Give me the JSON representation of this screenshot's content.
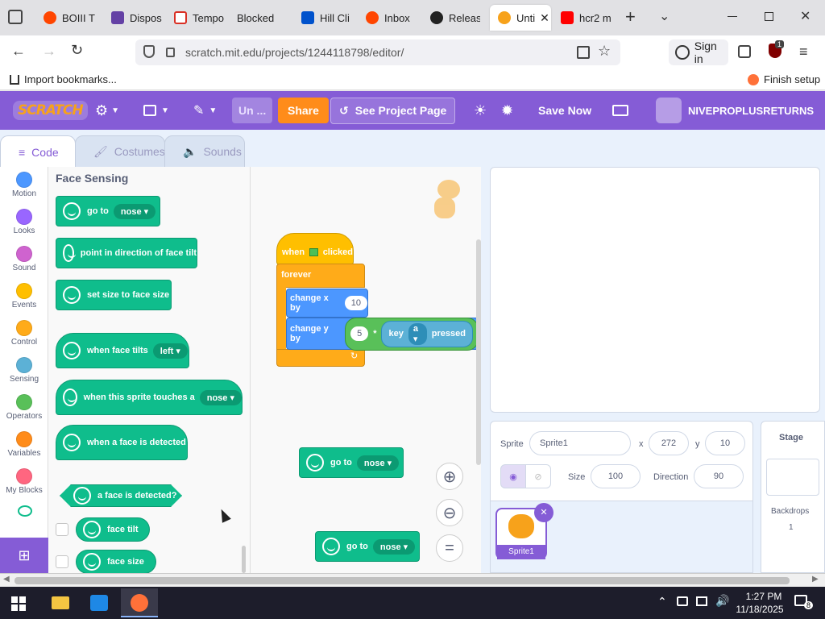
{
  "browser": {
    "tabs": [
      {
        "label": "BOIII T",
        "color": "#ff4500"
      },
      {
        "label": "Dispos",
        "color": "#6441a5"
      },
      {
        "label": "Tempo",
        "color": "#d93025"
      },
      {
        "label": "Blocked",
        "color": "#888888"
      },
      {
        "label": "Hill Cli",
        "color": "#0052cc"
      },
      {
        "label": "Inbox",
        "color": "#ff4500"
      },
      {
        "label": "Releas",
        "color": "#222222"
      },
      {
        "label": "Unti",
        "color": "#f7a21b"
      },
      {
        "label": "hcr2 m",
        "color": "#ff0000"
      }
    ],
    "url": "scratch.mit.edu/projects/1244118798/editor/",
    "sign_in": "Sign in",
    "import_bookmarks": "Import bookmarks...",
    "finish_setup": "Finish setup",
    "badge_count": "1"
  },
  "menubar": {
    "logo": "SCRATCH",
    "project_title": "Un ...",
    "share": "Share",
    "see_project": "See Project Page",
    "save_now": "Save Now",
    "username": "NIVEPROPLUSRETURNS"
  },
  "editor_tabs": {
    "code": "Code",
    "costumes": "Costumes",
    "sounds": "Sounds"
  },
  "categories": [
    {
      "label": "Motion",
      "color": "#4c97ff"
    },
    {
      "label": "Looks",
      "color": "#9966ff"
    },
    {
      "label": "Sound",
      "color": "#cf63cf"
    },
    {
      "label": "Events",
      "color": "#ffbf00"
    },
    {
      "label": "Control",
      "color": "#ffab19"
    },
    {
      "label": "Sensing",
      "color": "#5cb1d6"
    },
    {
      "label": "Operators",
      "color": "#59c059"
    },
    {
      "label": "Variables",
      "color": "#ff8c1a"
    },
    {
      "label": "My Blocks",
      "color": "#ff6680"
    }
  ],
  "palette": {
    "heading": "Face Sensing",
    "go_to": "go to",
    "go_to_opt": "nose",
    "point_direction": "point in direction of face tilt",
    "set_size": "set size to face size",
    "when_face_tilts": "when face tilts",
    "when_face_tilts_opt": "left",
    "when_sprite_touches": "when this sprite touches a",
    "when_sprite_touches_opt": "nose",
    "when_face_detected": "when a face is detected",
    "a_face_detected": "a face is detected?",
    "face_tilt": "face tilt",
    "face_size": "face size"
  },
  "scripts": {
    "when": "when",
    "clicked": "clicked",
    "forever": "forever",
    "change_x": "change x by",
    "change_x_val": "10",
    "change_y": "change y by",
    "change_y_val": "5",
    "op_symbol": "*",
    "key": "key",
    "key_opt": "a",
    "pressed": "pressed",
    "goto1": "go to",
    "goto1_opt": "nose",
    "goto2": "go to",
    "goto2_opt": "nose"
  },
  "sprite": {
    "label": "Sprite",
    "name": "Sprite1",
    "x_label": "x",
    "x": "272",
    "y_label": "y",
    "y": "10",
    "size_label": "Size",
    "size": "100",
    "direction_label": "Direction",
    "direction": "90",
    "thumb_name": "Sprite1"
  },
  "stage_pane": {
    "title": "Stage",
    "backdrops_label": "Backdrops",
    "backdrops_count": "1"
  },
  "taskbar": {
    "time": "1:27 PM",
    "date": "11/18/2025",
    "notif": "8"
  }
}
